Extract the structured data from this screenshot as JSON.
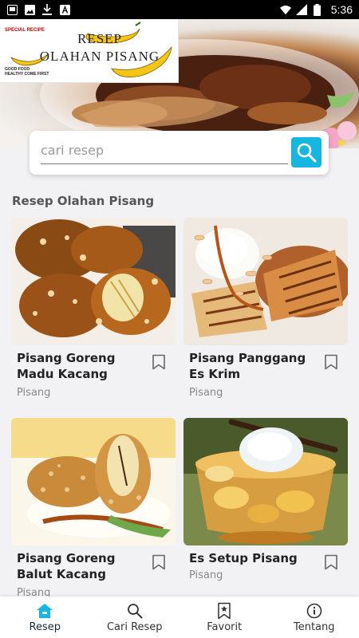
{
  "status_bar": {
    "time": "5:36",
    "left_icons": [
      "photo-icon",
      "image-icon",
      "download-icon",
      "a-icon"
    ],
    "right_icons": [
      "wifi-icon",
      "signal-icon",
      "battery-icon"
    ]
  },
  "banner": {
    "special": "SPECIAL RECIPE",
    "title_line1": "RESEP",
    "title_line2": "OLAHAN PISANG",
    "tagline_line1": "GOOD FOOD",
    "tagline_line2": "HEALTHY COME FIRST"
  },
  "search": {
    "placeholder": "cari resep",
    "value": ""
  },
  "section_title": "Resep Olahan Pisang",
  "recipes": [
    {
      "name": "Pisang Goreng Madu Kacang",
      "category": "Pisang"
    },
    {
      "name": "Pisang Panggang Es Krim",
      "category": "Pisang"
    },
    {
      "name": "Pisang Goreng Balut Kacang",
      "category": "Pisang"
    },
    {
      "name": "Es Setup Pisang",
      "category": "Pisang"
    }
  ],
  "nav": {
    "items": [
      {
        "label": "Resep",
        "icon": "home-icon",
        "active": true
      },
      {
        "label": "Cari Resep",
        "icon": "search-icon",
        "active": false
      },
      {
        "label": "Favorit",
        "icon": "bookmark-star-icon",
        "active": false
      },
      {
        "label": "Tentang",
        "icon": "info-icon",
        "active": false
      }
    ]
  },
  "colors": {
    "accent": "#17b6e0",
    "background": "#f2f2f5",
    "text_primary": "#222222",
    "text_secondary": "#888888"
  }
}
